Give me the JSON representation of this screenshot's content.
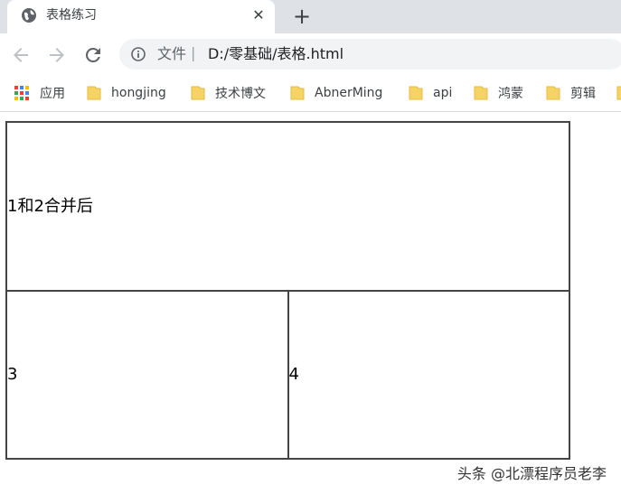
{
  "tab": {
    "title": "表格练习",
    "favicon": "globe-icon",
    "close": "close-icon",
    "new_tab": "plus-icon"
  },
  "toolbar": {
    "back": "back-arrow-icon",
    "forward": "forward-arrow-icon",
    "reload": "reload-icon",
    "info": "info-icon",
    "file_label": "文件",
    "separator": "|",
    "url": "D:/零基础/表格.html"
  },
  "bookmarks": {
    "apps_label": "应用",
    "items": [
      {
        "label": "hongjing"
      },
      {
        "label": "技术博文"
      },
      {
        "label": "AbnerMing"
      },
      {
        "label": "api"
      },
      {
        "label": "鸿蒙"
      },
      {
        "label": "剪辑"
      }
    ]
  },
  "table": {
    "merged_cell": "1和2合并后",
    "cell_3": "3",
    "cell_4": "4"
  },
  "watermark": "头条 @北漂程序员老李",
  "colors": {
    "tabstrip": "#dee1e6",
    "omnibox": "#f1f3f4",
    "folder": "#f6d365",
    "border": "#444444"
  }
}
